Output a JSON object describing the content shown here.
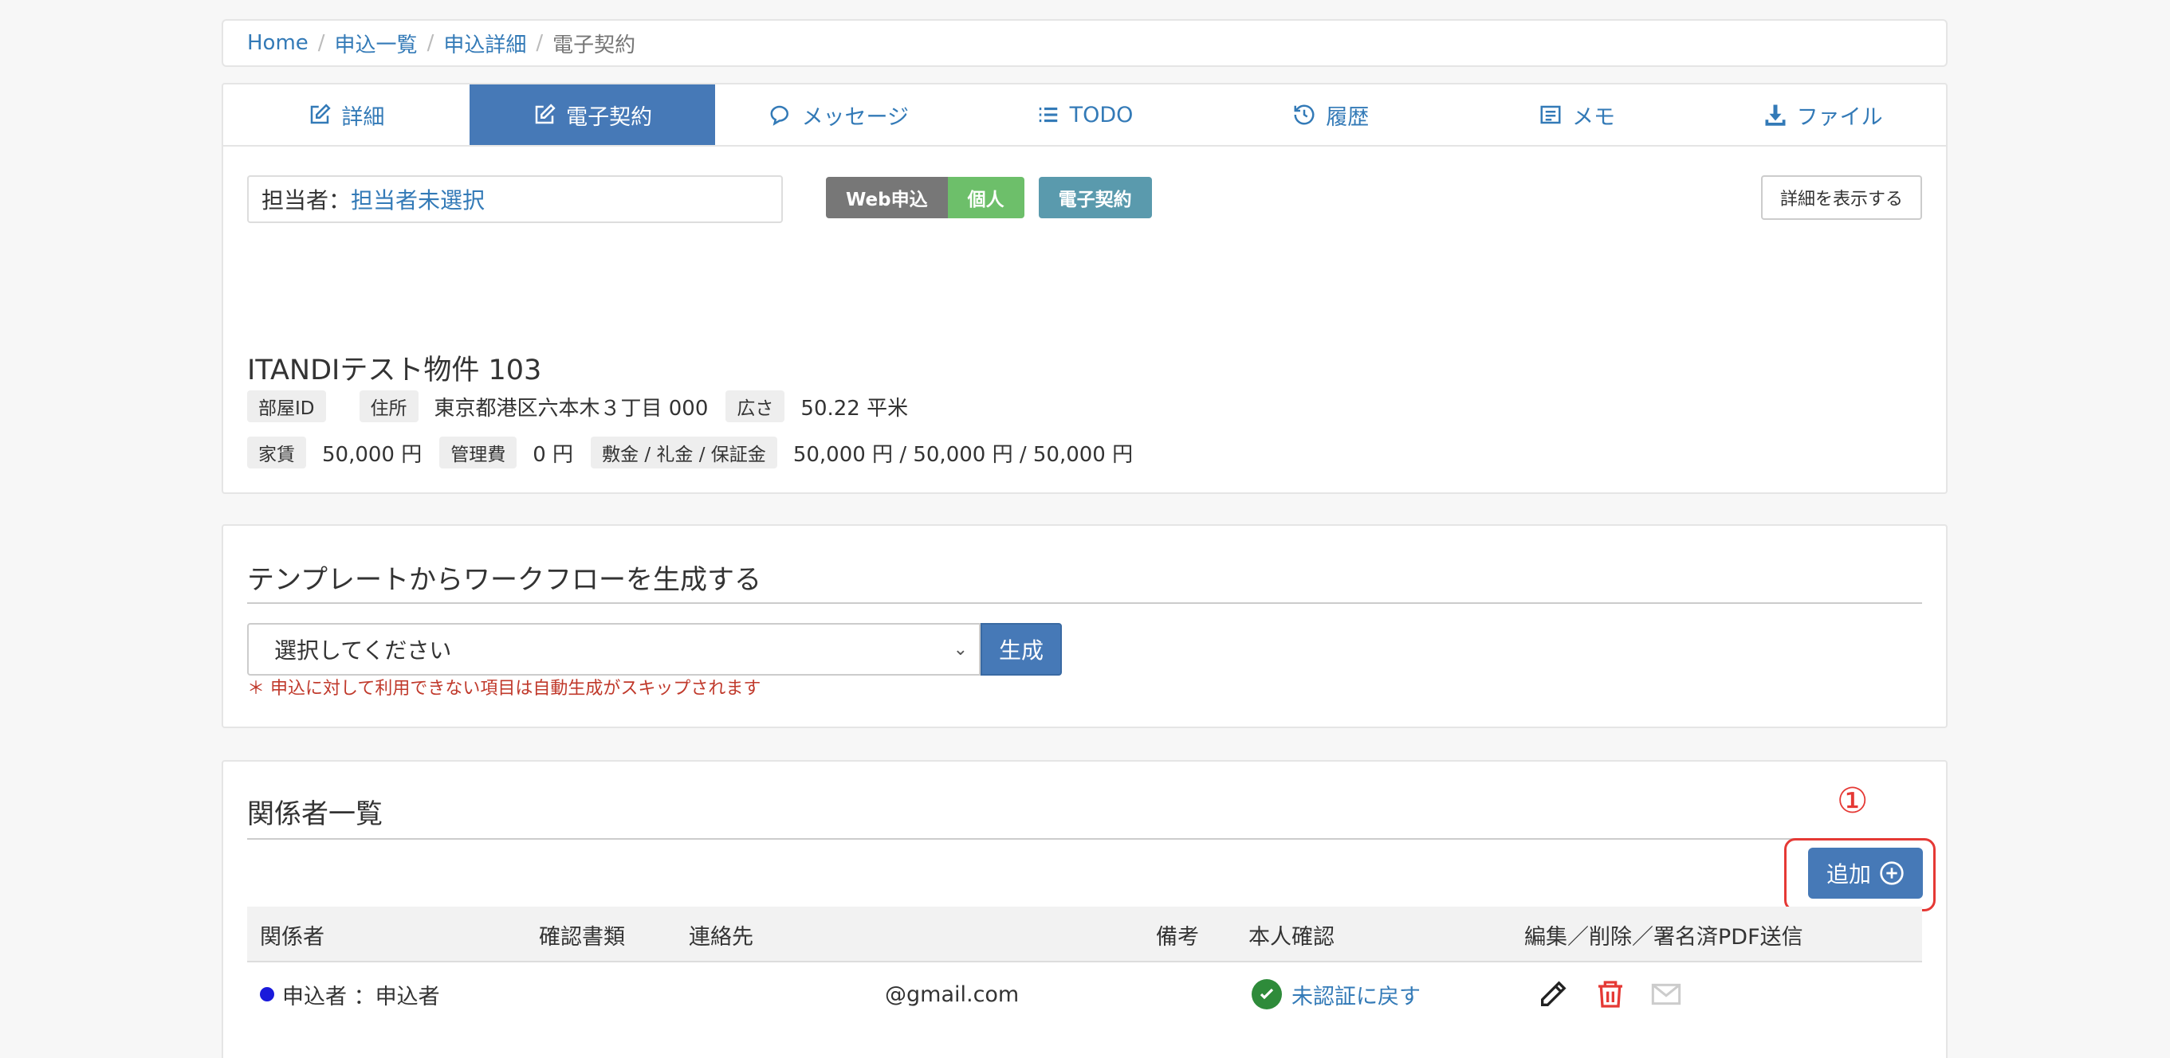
{
  "breadcrumb": {
    "items": [
      "Home",
      "申込一覧",
      "申込詳細"
    ],
    "current": "電子契約",
    "separator": "/"
  },
  "tabs": [
    {
      "label": "詳細",
      "icon": "edit-icon",
      "active": false
    },
    {
      "label": "電子契約",
      "icon": "edit-icon",
      "active": true
    },
    {
      "label": "メッセージ",
      "icon": "chat-icon",
      "active": false
    },
    {
      "label": "TODO",
      "icon": "list-icon",
      "active": false
    },
    {
      "label": "履歴",
      "icon": "history-icon",
      "active": false
    },
    {
      "label": "メモ",
      "icon": "memo-icon",
      "active": false
    },
    {
      "label": "ファイル",
      "icon": "download-icon",
      "active": false
    }
  ],
  "assignee": {
    "label": "担当者：",
    "value": "担当者未選択"
  },
  "badges": {
    "web": "Web申込",
    "kojin": "個人",
    "contract": "電子契約"
  },
  "detail_button": "詳細を表示する",
  "property": {
    "title": "ITANDIテスト物件 103",
    "room_id_label": "部屋ID",
    "room_id_value": "",
    "address_label": "住所",
    "address_value": "東京都港区六本木３丁目 000",
    "area_label": "広さ",
    "area_value": "50.22 平米",
    "rent_label": "家賃",
    "rent_value": "50,000 円",
    "mgmt_label": "管理費",
    "mgmt_value": "0 円",
    "deposit_label": "敷金 / 礼金 / 保証金",
    "deposit_value": "50,000 円 / 50,000 円 / 50,000 円"
  },
  "workflow": {
    "title": "テンプレートからワークフローを生成する",
    "select_value": "選択してください",
    "generate_button": "生成",
    "warning": "＊ 申込に対して利用できない項目は自動生成がスキップされます"
  },
  "members": {
    "title": "関係者一覧",
    "marker": "①",
    "add_button": "追加",
    "columns": [
      "関係者",
      "確認書類",
      "連絡先",
      "備考",
      "本人確認",
      "編集／削除／署名済PDF送信"
    ],
    "rows": [
      {
        "party": "申込者 ：申込者",
        "documents": "",
        "contact": "@gmail.com",
        "note": "",
        "verification": "未認証に戻す"
      }
    ]
  },
  "colors": {
    "accent": "#4679b7",
    "link": "#337ab7",
    "badge_web": "#777777",
    "badge_kojin": "#6dbf6a",
    "badge_contract": "#5a9aad",
    "delete": "#e53935",
    "verified": "#2e8b3a",
    "highlight": "#e53935"
  }
}
